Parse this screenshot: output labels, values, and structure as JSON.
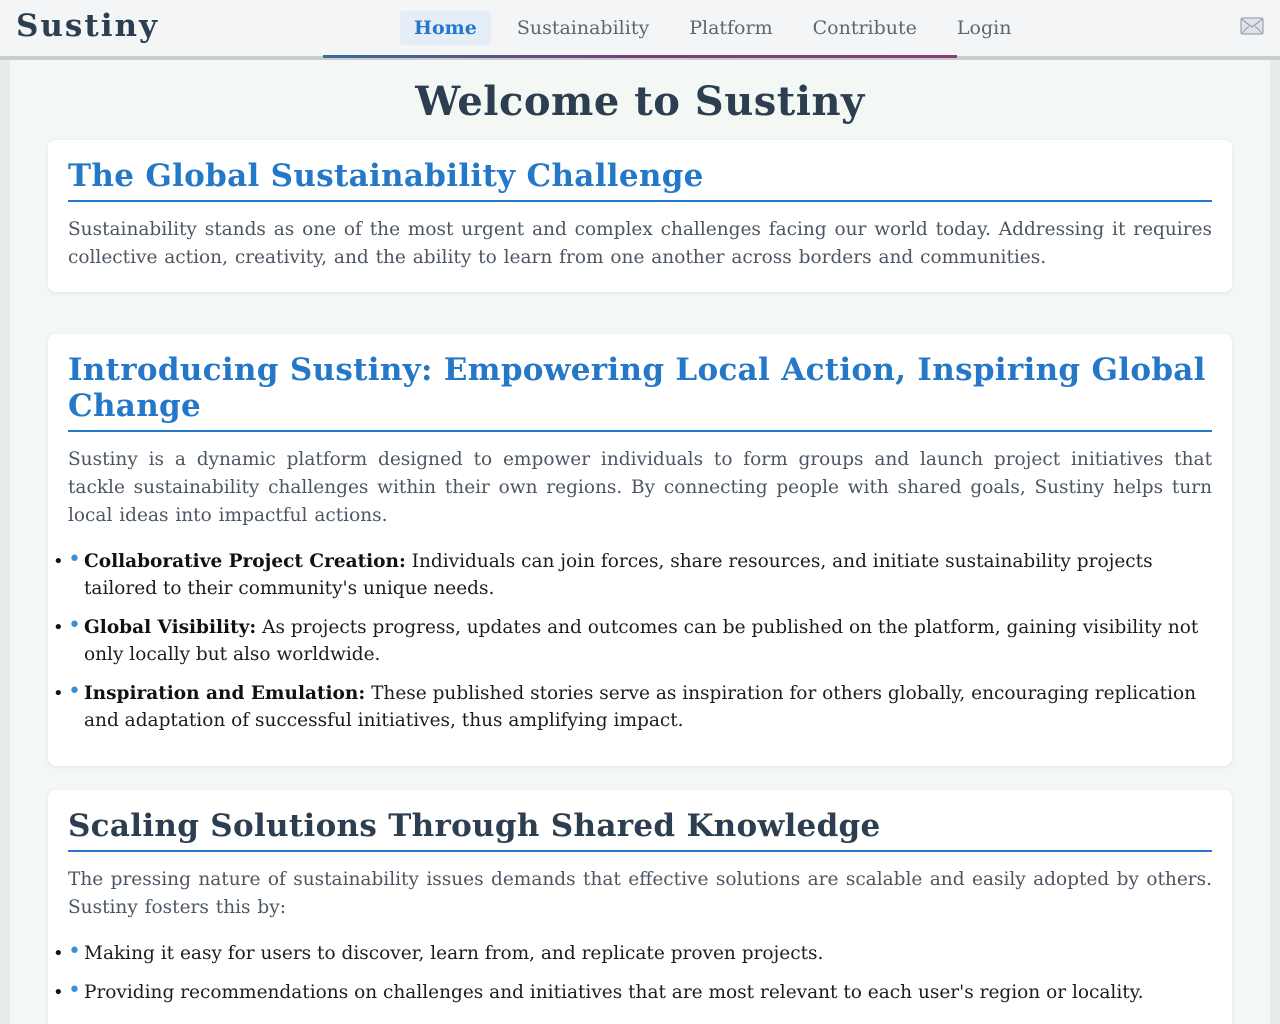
{
  "brand": "Sustiny",
  "nav": {
    "items": [
      "Home",
      "Sustainability",
      "Platform",
      "Contribute",
      "Login"
    ],
    "active": "Home"
  },
  "page_title": "Welcome to Sustiny",
  "sections": [
    {
      "title": "The Global Sustainability Challenge",
      "paragraph": "Sustainability stands as one of the most urgent and complex challenges facing our world today. Addressing it requires collective action, creativity, and the ability to learn from one another across borders and communities."
    },
    {
      "title": "Introducing Sustiny: Empowering Local Action, Inspiring Global Change",
      "paragraph": "Sustiny is a dynamic platform designed to empower individuals to form groups and launch project initiatives that tackle sustainability challenges within their own regions. By connecting people with shared goals, Sustiny helps turn local ideas into impactful actions.",
      "bullets": [
        {
          "label": "Collaborative Project Creation:",
          "text": "Individuals can join forces, share resources, and initiate sustainability projects tailored to their community's unique needs."
        },
        {
          "label": "Global Visibility:",
          "text": "As projects progress, updates and outcomes can be published on the platform, gaining visibility not only locally but also worldwide."
        },
        {
          "label": "Inspiration and Emulation:",
          "text": "These published stories serve as inspiration for others globally, encouraging replication and adaptation of successful initiatives, thus amplifying impact."
        }
      ]
    },
    {
      "title": "Scaling Solutions Through Shared Knowledge",
      "paragraph": "The pressing nature of sustainability issues demands that effective solutions are scalable and easily adopted by others. Sustiny fosters this by:",
      "bullets": [
        {
          "text": "Making it easy for users to discover, learn from, and replicate proven projects."
        },
        {
          "text": "Providing recommendations on challenges and initiatives that are most relevant to each user's region or locality."
        }
      ]
    }
  ]
}
